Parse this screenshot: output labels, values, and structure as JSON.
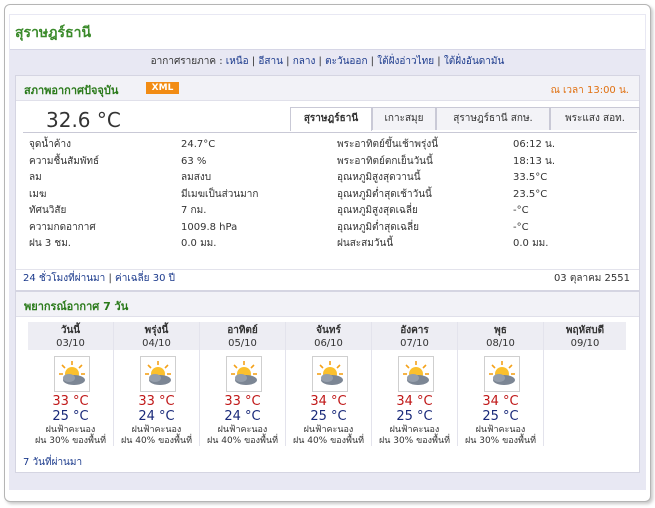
{
  "page": {
    "province_title": "สุราษฎร์ธานี",
    "regions_prefix": "อากาศรายภาค :",
    "regions": [
      "เหนือ",
      "อีสาน",
      "กลาง",
      "ตะวันออก",
      "ใต้ฝั่งอ่าวไทย",
      "ใต้ฝั่งอันดามัน"
    ]
  },
  "current": {
    "title": "สภาพอากาศปัจจุบัน",
    "xml_label": "XML",
    "time_note": "ณ เวลา 13:00 น.",
    "temperature": "32.6 °C",
    "tabs": [
      "สุราษฎร์ธานี",
      "เกาะสมุย",
      "สุราษฎร์ธานี สกษ.",
      "พระแสง สอท."
    ],
    "active_tab": 0,
    "left": [
      {
        "label": "จุดน้ำค้าง",
        "value": "24.7°C"
      },
      {
        "label": "ความชื้นสัมพัทธ์",
        "value": "63 %"
      },
      {
        "label": "ลม",
        "value": "ลมสงบ"
      },
      {
        "label": "เมฆ",
        "value": "มีเมฆเป็นส่วนมาก"
      },
      {
        "label": "ทัศนวิสัย",
        "value": "7 กม."
      },
      {
        "label": "ความกดอากาศ",
        "value": "1009.8 hPa"
      },
      {
        "label": "ฝน 3 ชม.",
        "value": "0.0 มม."
      }
    ],
    "right": [
      {
        "label": "พระอาทิตย์ขึ้นเช้าพรุ่งนี้",
        "value": "06:12 น."
      },
      {
        "label": "พระอาทิตย์ตกเย็นวันนี้",
        "value": "18:13 น."
      },
      {
        "label": "อุณหภูมิสูงสุดวานนี้",
        "value": "33.5°C"
      },
      {
        "label": "อุณหภูมิต่ำสุดเช้าวันนี้",
        "value": "23.5°C"
      },
      {
        "label": "อุณหภูมิสูงสุดเฉลี่ย",
        "value": "-°C"
      },
      {
        "label": "อุณหภูมิต่ำสุดเฉลี่ย",
        "value": "-°C"
      },
      {
        "label": "ฝนสะสมวันนี้",
        "value": "0.0 มม."
      }
    ],
    "link_24h": "24 ชั่วโมงที่ผ่านมา",
    "link_30d": "ค่าเฉลี่ย 30 ปี",
    "date": "03 ตุลาคม 2551"
  },
  "forecast": {
    "title": "พยากรณ์อากาศ 7 วัน",
    "past_link": "7 วันที่ผ่านมา",
    "days": [
      {
        "day": "วันนี้",
        "date": "03/10",
        "icon": "partly-cloudy-icon",
        "max": "33 °C",
        "min": "25 °C",
        "cond": "ฝนฟ้าคะนอง",
        "chance": "ฝน 30% ของพื้นที่"
      },
      {
        "day": "พรุ่งนี้",
        "date": "04/10",
        "icon": "partly-cloudy-icon",
        "max": "33 °C",
        "min": "24 °C",
        "cond": "ฝนฟ้าคะนอง",
        "chance": "ฝน 40% ของพื้นที่"
      },
      {
        "day": "อาทิตย์",
        "date": "05/10",
        "icon": "partly-cloudy-icon",
        "max": "33 °C",
        "min": "24 °C",
        "cond": "ฝนฟ้าคะนอง",
        "chance": "ฝน 40% ของพื้นที่"
      },
      {
        "day": "จันทร์",
        "date": "06/10",
        "icon": "partly-cloudy-icon",
        "max": "34 °C",
        "min": "25 °C",
        "cond": "ฝนฟ้าคะนอง",
        "chance": "ฝน 40% ของพื้นที่"
      },
      {
        "day": "อังคาร",
        "date": "07/10",
        "icon": "partly-cloudy-icon",
        "max": "34 °C",
        "min": "25 °C",
        "cond": "ฝนฟ้าคะนอง",
        "chance": "ฝน 30% ของพื้นที่"
      },
      {
        "day": "พุธ",
        "date": "08/10",
        "icon": "partly-cloudy-icon",
        "max": "34 °C",
        "min": "25 °C",
        "cond": "ฝนฟ้าคะนอง",
        "chance": "ฝน 30% ของพื้นที่"
      },
      {
        "day": "พฤหัสบดี",
        "date": "09/10"
      }
    ]
  },
  "colors": {
    "title_green": "#3a8a2a",
    "link_blue": "#1b3a8c",
    "max_red": "#c01818",
    "min_navy": "#1a2a7a",
    "xml_orange": "#f28c14"
  }
}
